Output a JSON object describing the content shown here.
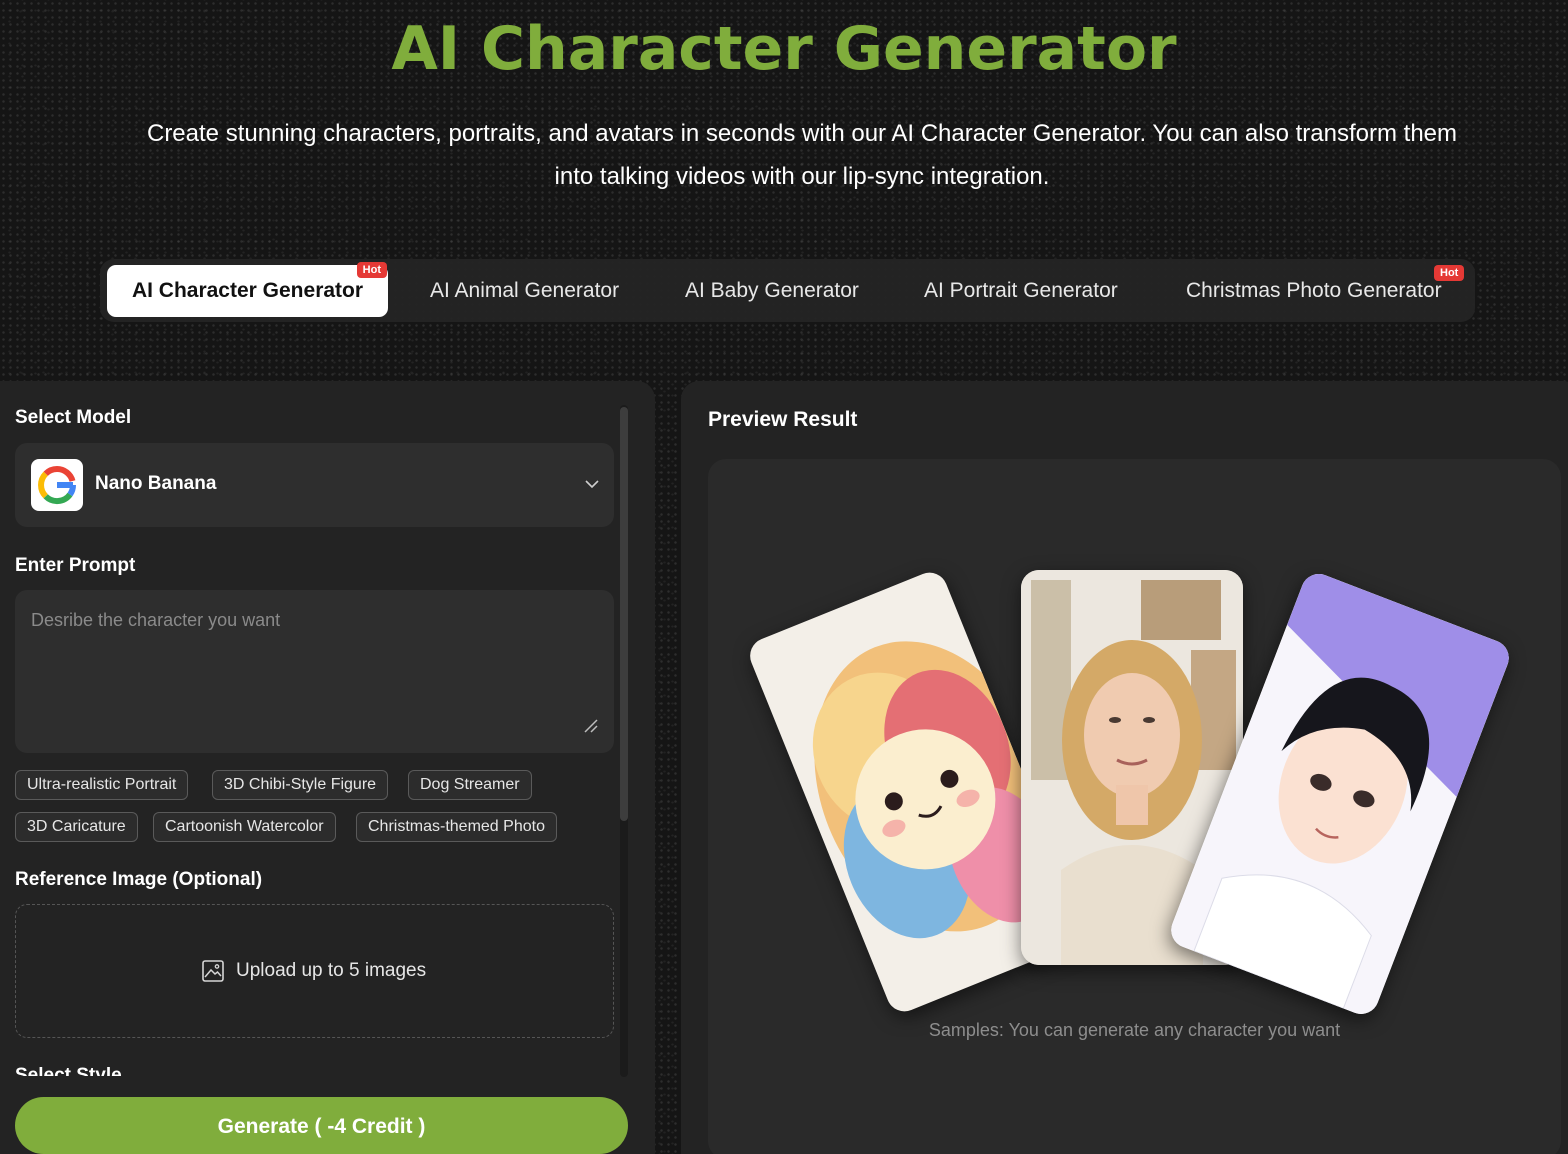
{
  "hero": {
    "title": "AI Character Generator",
    "subtitle": "Create stunning characters, portraits, and avatars in seconds with our AI Character Generator. You can also transform them into talking videos with our lip-sync integration."
  },
  "tabs": [
    {
      "label": "AI Character Generator",
      "active": true,
      "badge": "Hot"
    },
    {
      "label": "AI Animal Generator",
      "active": false
    },
    {
      "label": "AI Baby Generator",
      "active": false
    },
    {
      "label": "AI Portrait Generator",
      "active": false
    },
    {
      "label": "Christmas Photo Generator",
      "active": false,
      "badge": "Hot"
    }
  ],
  "form": {
    "model_label": "Select Model",
    "model_name": "Nano Banana",
    "prompt_label": "Enter Prompt",
    "prompt_placeholder": "Desribe the character you want",
    "chips": [
      "Ultra-realistic Portrait",
      "3D Chibi-Style Figure",
      "Dog Streamer",
      "3D Caricature",
      "Cartoonish Watercolor",
      "Christmas-themed Photo"
    ],
    "reference_label": "Reference Image (Optional)",
    "upload_text": "Upload up to 5 images",
    "style_label": "Select Style",
    "generate_label": "Generate ( -4 Credit )"
  },
  "preview": {
    "title": "Preview Result",
    "caption": "Samples: You can generate any character you want"
  },
  "colors": {
    "accent": "#80ad3c",
    "hot_badge": "#e53935",
    "panel": "#232323"
  },
  "icons": [
    "google-logo-icon",
    "chevron-down-icon",
    "resize-handle-icon",
    "image-icon"
  ]
}
